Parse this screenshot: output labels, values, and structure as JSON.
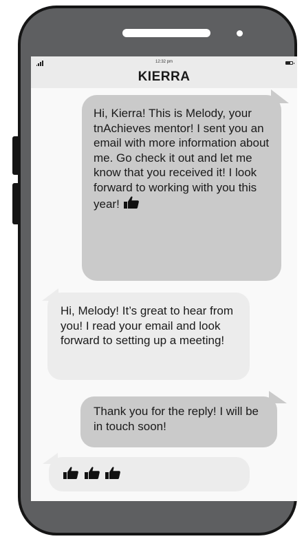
{
  "status_bar": {
    "time": "12:32 pm",
    "contact_name": "KIERRA",
    "signal_icon": "signal-bars-icon",
    "battery_icon": "battery-icon"
  },
  "messages": [
    {
      "direction": "sent",
      "text": "Hi, Kierra! This is Melody, your tnAchieves mentor! I sent you an email with more information about me. Go check it out and let me know that you received it! I look forward to working with you this year!",
      "emoji": "thumbs-up-icon"
    },
    {
      "direction": "received",
      "text": "Hi, Melody! It’s great to hear from you! I read your email and look forward to setting up a meeting!"
    },
    {
      "direction": "sent",
      "text": "Thank you for the reply! I will be in touch soon!"
    },
    {
      "direction": "received",
      "emoji": [
        "thumbs-up-icon",
        "thumbs-up-icon",
        "thumbs-up-icon"
      ]
    }
  ],
  "colors": {
    "phone_body": "#5e5f61",
    "phone_outline": "#151515",
    "screen_bg": "#f9f9f9",
    "header_bg": "#ebebeb",
    "sent_bubble": "#cacaca",
    "received_bubble": "#ececec"
  }
}
